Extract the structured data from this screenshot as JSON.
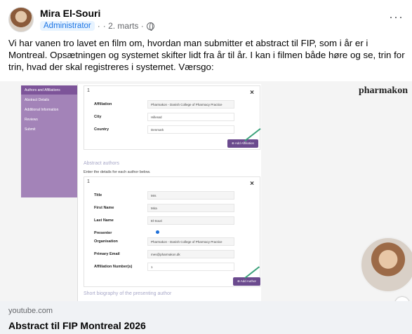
{
  "post": {
    "author": "Mira El-Souri",
    "role": "Administrator",
    "separator": "·",
    "date": "· 2. marts ·",
    "privacy_icon": "globe-icon",
    "more_icon": "more-options-icon",
    "more_label": "···",
    "text": "Vi har vanen tro lavet en film om, hvordan man submitter et abstract til FIP, som i år er i Montreal. Opsætningen og systemet skifter lidt fra år til år. I kan i filmen både høre og se, trin for trin, hvad der skal registreres i systemet. Værsgo:"
  },
  "video": {
    "brand": "pharmakon",
    "sidebar": [
      "Authors and Affiliations",
      "Abstract Details",
      "Additional Information",
      "Reviews",
      "Submit"
    ],
    "affiliation_section": {
      "index": "1",
      "close": "×",
      "fields": [
        {
          "label": "Affiliation",
          "value": "Pharmakon - Danish College of Pharmacy Practice"
        },
        {
          "label": "City",
          "value": "Hillerød"
        },
        {
          "label": "Country",
          "value": "Denmark"
        }
      ],
      "add_button": "⊕ Add Affiliation"
    },
    "authors_heading": "Abstract authors",
    "authors_note": "Enter the details for each author below.",
    "author_section": {
      "index": "1",
      "close": "×",
      "fields": [
        {
          "label": "Title",
          "value": "Mrs"
        },
        {
          "label": "First Name",
          "value": "Mira"
        },
        {
          "label": "Last Name",
          "value": "El-Souri"
        },
        {
          "label": "Presenter",
          "value": ""
        },
        {
          "label": "Organisation",
          "value": "Pharmakon - Danish College of Pharmacy Practice"
        },
        {
          "label": "Primary Email",
          "value": "mes@pharmakon.dk"
        },
        {
          "label": "Affiliation Number(s)",
          "value": "1"
        }
      ],
      "add_button": "⊕ Add Author"
    },
    "bio_heading": "Short biography of the presenting author",
    "info_icon": "info-icon",
    "info_label": "i"
  },
  "link": {
    "domain": "youtube.com",
    "title": "Abstract til FIP Montreal 2026"
  }
}
